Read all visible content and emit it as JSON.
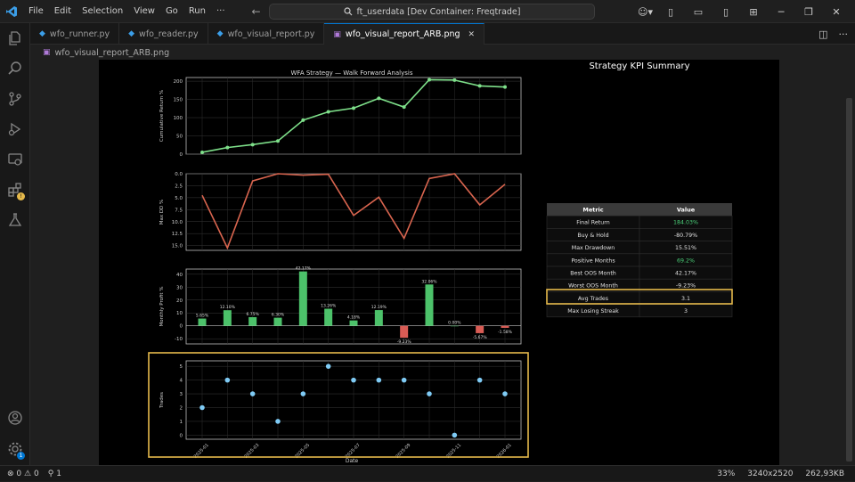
{
  "titlebar": {
    "menu": [
      "File",
      "Edit",
      "Selection",
      "View",
      "Go",
      "Run",
      "···"
    ],
    "search": "ft_userdata [Dev Container: Freqtrade]"
  },
  "tabs": [
    {
      "label": "wfo_runner.py",
      "kind": "py",
      "active": false
    },
    {
      "label": "wfo_reader.py",
      "kind": "py",
      "active": false
    },
    {
      "label": "wfo_visual_report.py",
      "kind": "py",
      "active": false
    },
    {
      "label": "wfo_visual_report_ARB.png",
      "kind": "img",
      "active": true
    }
  ],
  "breadcrumb": "wfo_visual_report_ARB.png",
  "statusbar": {
    "errors": "0",
    "warnings": "0",
    "ports": "1",
    "zoom": "33%",
    "dimensions": "3240x2520",
    "filesize": "262,93KB"
  },
  "colors": {
    "accent": "#0078d4",
    "line_green": "#7ee08a",
    "line_red": "#d9654f",
    "bar_green": "#4cc26a",
    "bar_red": "#d95c55",
    "scatter": "#7fcbf5",
    "highlight": "#e5b94b"
  },
  "figure": {
    "title": "WFA Strategy — Walk Forward Analysis",
    "kpi_title": "Strategy KPI Summary",
    "xlabel": "Date"
  },
  "chart_data": [
    {
      "type": "line",
      "name": "cumulative-return",
      "ylabel": "Cumulative Return %",
      "x": [
        0,
        1,
        2,
        3,
        4,
        5,
        6,
        7,
        8,
        9,
        10,
        11,
        12
      ],
      "values": [
        5,
        18,
        26,
        36,
        93,
        116,
        126,
        153,
        129,
        204,
        203,
        187,
        184
      ],
      "ylim": [
        0,
        210
      ],
      "yticks": [
        0,
        50,
        100,
        150,
        200
      ],
      "grid": true
    },
    {
      "type": "line",
      "name": "max-dd",
      "ylabel": "Max DD %",
      "x": [
        0,
        1,
        2,
        3,
        4,
        5,
        6,
        7,
        8,
        9,
        10,
        11,
        12
      ],
      "values": [
        4.5,
        15.5,
        1.5,
        0.0,
        0.3,
        0.1,
        8.7,
        4.9,
        13.5,
        1.0,
        0.0,
        6.5,
        2.2
      ],
      "ylim": [
        0,
        16
      ],
      "yticks": [
        0.0,
        2.5,
        5.0,
        7.5,
        10.0,
        12.5,
        15.0
      ],
      "inverted": true,
      "grid": true
    },
    {
      "type": "bar",
      "name": "monthly-profit",
      "ylabel": "Monthly Profit %",
      "values": [
        5.65,
        12.1,
        6.75,
        6.3,
        42.17,
        13.26,
        4.18,
        12.19,
        -9.23,
        32.06,
        0.0,
        -5.67,
        -1.58
      ],
      "labels": [
        "5.65%",
        "12.10%",
        "6.75%",
        "6.30%",
        "42.17%",
        "13.26%",
        "4.18%",
        "12.19%",
        "-9.23%",
        "32.06%",
        "0.00%",
        "-5.67%",
        "-1.58%"
      ],
      "ylim": [
        -14,
        44
      ],
      "yticks": [
        -10,
        0,
        10,
        20,
        30,
        40
      ],
      "grid": true
    },
    {
      "type": "scatter",
      "name": "trades",
      "ylabel": "Trades",
      "values": [
        2,
        4,
        3,
        1,
        3,
        5,
        4,
        4,
        4,
        3,
        0,
        4,
        3
      ],
      "ylim": [
        -0.3,
        5.4
      ],
      "yticks": [
        0,
        1,
        2,
        3,
        4,
        5
      ],
      "xticks": [
        "2025-01",
        "2025-03",
        "2025-05",
        "2025-07",
        "2025-09",
        "2025-11",
        "2026-01"
      ],
      "grid": true
    }
  ],
  "kpi_table": {
    "headers": [
      "Metric",
      "Value"
    ],
    "rows": [
      {
        "metric": "Final Return",
        "value": "184.03%",
        "positive": true
      },
      {
        "metric": "Buy & Hold",
        "value": "-80.79%",
        "positive": false
      },
      {
        "metric": "Max Drawdown",
        "value": "15.51%",
        "positive": false
      },
      {
        "metric": "Positive Months",
        "value": "69.2%",
        "positive": true
      },
      {
        "metric": "Best OOS Month",
        "value": "42.17%",
        "positive": false
      },
      {
        "metric": "Worst OOS Month",
        "value": "-9.23%",
        "positive": false
      },
      {
        "metric": "Avg Trades",
        "value": "3.1",
        "positive": false,
        "highlight": true
      },
      {
        "metric": "Max Losing Streak",
        "value": "3",
        "positive": false
      }
    ]
  }
}
